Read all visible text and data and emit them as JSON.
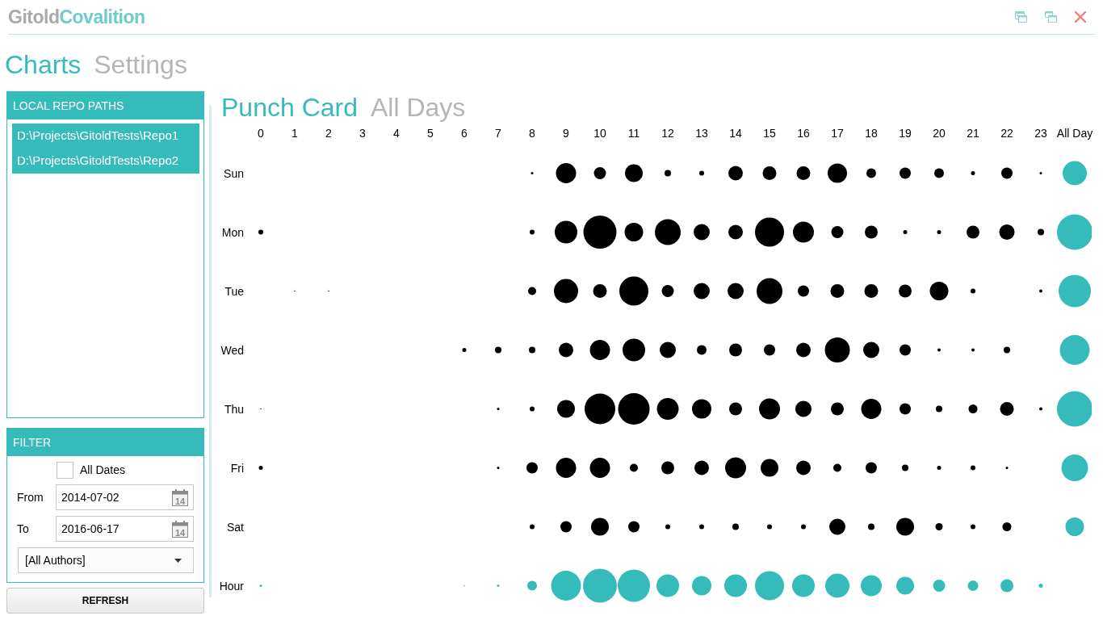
{
  "app_title": {
    "part_1": "Gitold",
    "part_2": "Covalition"
  },
  "nav_tabs": [
    {
      "label": "Charts",
      "selected": true
    },
    {
      "label": "Settings",
      "selected": false
    }
  ],
  "repo_paths": {
    "header": "LOCAL REPO PATHS",
    "items": [
      {
        "label": "D:\\Projects\\GitoldTests\\Repo1",
        "selected": true
      },
      {
        "label": "D:\\Projects\\GitoldTests\\Repo2",
        "selected": true
      }
    ]
  },
  "filter": {
    "header": "FILTER",
    "all_dates": {
      "label": "All Dates",
      "checked": false
    },
    "date_fields": [
      {
        "label": "From",
        "value": "2014-07-02",
        "calendar_day": "14"
      },
      {
        "label": "To",
        "value": "2016-06-17",
        "calendar_day": "14"
      }
    ],
    "author": {
      "value": "[All Authors]"
    }
  },
  "refresh_button": {
    "label": "REFRESH"
  },
  "chart_tabs": [
    {
      "label": "Punch Card",
      "selected": true
    },
    {
      "label": "All Days",
      "selected": false
    }
  ],
  "punch_card": {
    "columns": [
      {
        "label": "0",
        "kind": "hour"
      },
      {
        "label": "1",
        "kind": "hour"
      },
      {
        "label": "2",
        "kind": "hour"
      },
      {
        "label": "3",
        "kind": "hour"
      },
      {
        "label": "4",
        "kind": "hour"
      },
      {
        "label": "5",
        "kind": "hour"
      },
      {
        "label": "6",
        "kind": "hour"
      },
      {
        "label": "7",
        "kind": "hour"
      },
      {
        "label": "8",
        "kind": "hour"
      },
      {
        "label": "9",
        "kind": "hour"
      },
      {
        "label": "10",
        "kind": "hour"
      },
      {
        "label": "11",
        "kind": "hour"
      },
      {
        "label": "12",
        "kind": "hour"
      },
      {
        "label": "13",
        "kind": "hour"
      },
      {
        "label": "14",
        "kind": "hour"
      },
      {
        "label": "15",
        "kind": "hour"
      },
      {
        "label": "16",
        "kind": "hour"
      },
      {
        "label": "17",
        "kind": "hour"
      },
      {
        "label": "18",
        "kind": "hour"
      },
      {
        "label": "19",
        "kind": "hour"
      },
      {
        "label": "20",
        "kind": "hour"
      },
      {
        "label": "21",
        "kind": "hour"
      },
      {
        "label": "22",
        "kind": "hour"
      },
      {
        "label": "23",
        "kind": "hour"
      },
      {
        "label": "All Day",
        "kind": "total"
      }
    ],
    "rows": [
      {
        "label": "Sun",
        "kind": "day"
      },
      {
        "label": "Mon",
        "kind": "day"
      },
      {
        "label": "Tue",
        "kind": "day"
      },
      {
        "label": "Wed",
        "kind": "day"
      },
      {
        "label": "Thu",
        "kind": "day"
      },
      {
        "label": "Fri",
        "kind": "day"
      },
      {
        "label": "Sat",
        "kind": "day"
      },
      {
        "label": "Hour",
        "kind": "total"
      }
    ]
  }
}
